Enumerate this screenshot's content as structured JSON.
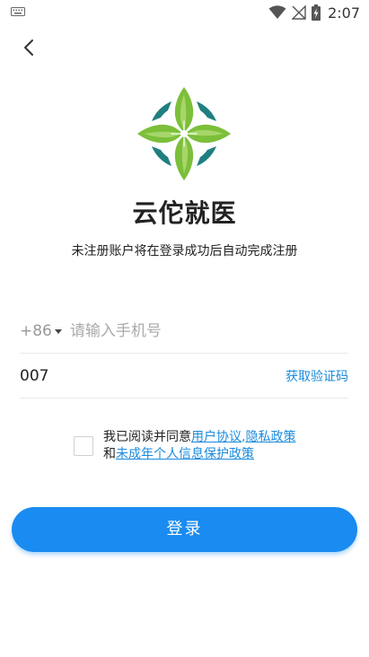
{
  "status_bar": {
    "time": "2:07",
    "icons": [
      "keyboard-icon",
      "wifi-icon",
      "signal-off-icon",
      "battery-charging-icon"
    ]
  },
  "header": {
    "back_icon": "chevron-left-icon"
  },
  "app": {
    "name": "云佗就医",
    "subtitle": "未注册账户将在登录成功后自动完成注册",
    "logo_icon": "four-leaf-clover-logo"
  },
  "form": {
    "country_code": "+86",
    "phone_value": "",
    "phone_placeholder": "请输入手机号",
    "code_value": "007",
    "get_code_label": "获取验证码"
  },
  "agreement": {
    "checked": false,
    "prefix": "我已阅读并同意",
    "user_agreement": "用户协议",
    "separator": ",",
    "privacy_policy": "隐私政策",
    "and": "和",
    "minor_policy": "未成年个人信息保护政策"
  },
  "actions": {
    "login_label": "登录"
  },
  "colors": {
    "accent": "#1a8bf0",
    "link": "#1a8bdc",
    "logo_green": "#7cbf3a",
    "logo_teal": "#1f7f80"
  }
}
